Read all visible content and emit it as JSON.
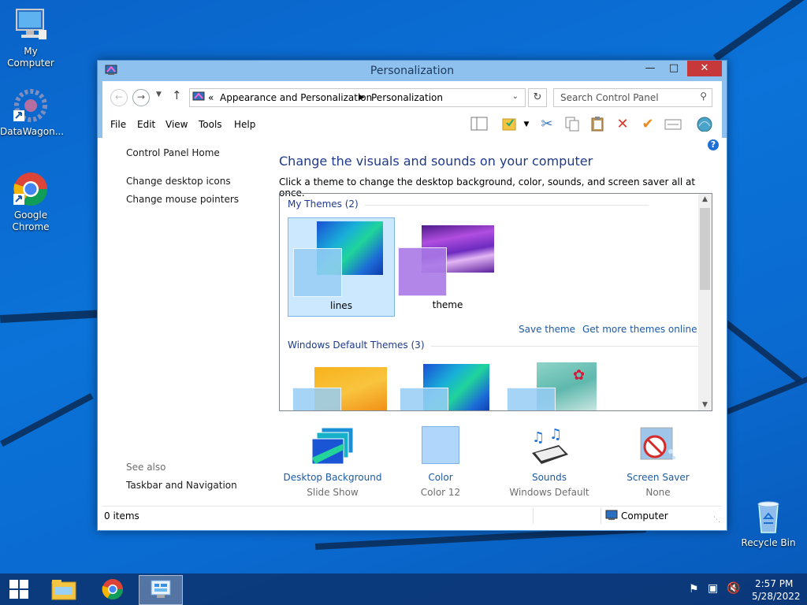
{
  "desktop": {
    "icons": [
      {
        "label": "My Computer"
      },
      {
        "label": "DataWagon..."
      },
      {
        "label": "Google Chrome"
      },
      {
        "label": "Recycle Bin"
      }
    ]
  },
  "window": {
    "title": "Personalization",
    "breadcrumb": [
      "Appearance and Personalization",
      "Personalization"
    ],
    "breadcrumb_prefix": "«",
    "search_placeholder": "Search Control Panel",
    "menu": [
      "File",
      "Edit",
      "View",
      "Tools",
      "Help"
    ],
    "left_links": [
      "Control Panel Home",
      "Change desktop icons",
      "Change mouse pointers"
    ],
    "see_also_label": "See also",
    "see_also_links": [
      "Taskbar and Navigation"
    ],
    "heading": "Change the visuals and sounds on your computer",
    "subtext": "Click a theme to change the desktop background, color, sounds, and screen saver all at once.",
    "my_themes_header": "My Themes (2)",
    "my_themes": [
      {
        "label": "lines",
        "selected": true
      },
      {
        "label": "theme",
        "selected": false
      }
    ],
    "save_theme": "Save theme",
    "get_more_themes": "Get more themes online",
    "default_themes_header": "Windows Default Themes (3)",
    "bottom": [
      {
        "title": "Desktop Background",
        "sub": "Slide Show"
      },
      {
        "title": "Color",
        "sub": "Color 12"
      },
      {
        "title": "Sounds",
        "sub": "Windows Default"
      },
      {
        "title": "Screen Saver",
        "sub": "None"
      }
    ],
    "status_items": "0 items",
    "status_location": "Computer"
  },
  "taskbar": {
    "time": "2:57 PM",
    "date": "5/28/2022"
  },
  "colors": {
    "accent": "#1c5aa7",
    "heading": "#1e3a8a",
    "titlebar": "#8fc1ee",
    "close": "#c7383a"
  }
}
